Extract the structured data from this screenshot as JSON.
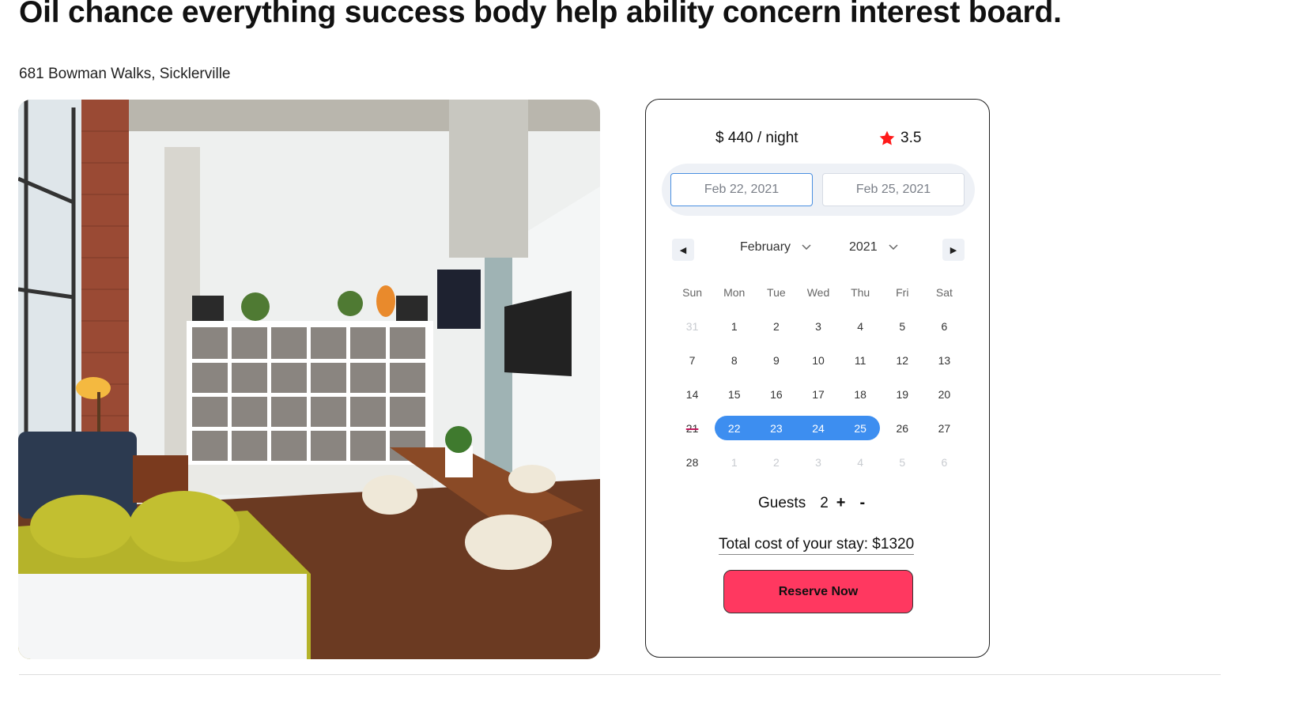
{
  "listing": {
    "title": "Oil chance everything success body help ability concern interest board.",
    "address": "681 Bowman Walks, Sicklerville",
    "photo_description": ""
  },
  "booking": {
    "price": "$ 440 / night",
    "rating": "3.5",
    "rating_icon": "star-icon",
    "rating_color": "#ff1a1a",
    "start_date": "Feb 22, 2021",
    "end_date": "Feb 25, 2021",
    "month": "February",
    "year": "2021",
    "weekdays": [
      "Sun",
      "Mon",
      "Tue",
      "Wed",
      "Thu",
      "Fri",
      "Sat"
    ],
    "weeks": [
      [
        "31",
        "1",
        "2",
        "3",
        "4",
        "5",
        "6"
      ],
      [
        "7",
        "8",
        "9",
        "10",
        "11",
        "12",
        "13"
      ],
      [
        "14",
        "15",
        "16",
        "17",
        "18",
        "19",
        "20"
      ],
      [
        "21",
        "22",
        "23",
        "24",
        "25",
        "26",
        "27"
      ],
      [
        "28",
        "1",
        "2",
        "3",
        "4",
        "5",
        "6"
      ]
    ],
    "guests_label": "Guests",
    "guests_count": "2",
    "plus_label": "+",
    "minus_label": "-",
    "total_label": "Total cost of your stay: $1320",
    "reserve_label": "Reserve Now",
    "accent_color": "#3d8ef0",
    "reserve_color": "#ff3860"
  }
}
